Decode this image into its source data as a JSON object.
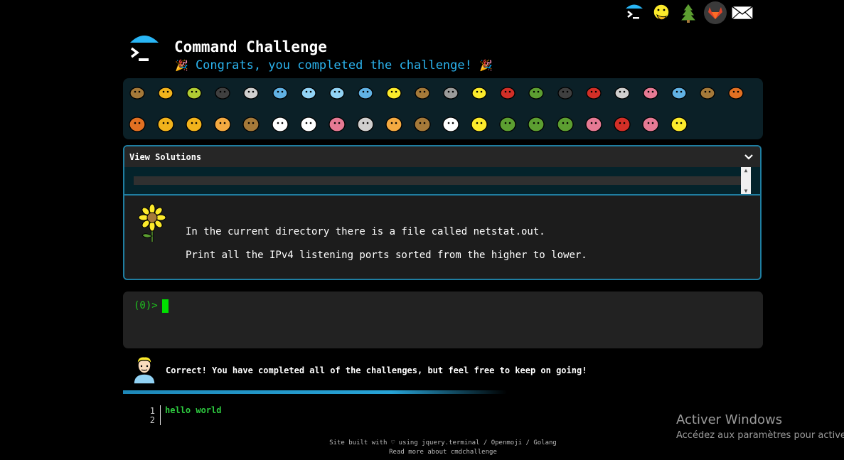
{
  "app": {
    "title": "Command Challenge",
    "subtitle": "Congrats, you completed the challenge!",
    "party_emoji": "🎉"
  },
  "top_icons": [
    "terminal-logo-icon",
    "face-with-hand-over-mouth-icon",
    "tree-icon",
    "gitlab-icon",
    "envelope-icon"
  ],
  "badges": {
    "row1": [
      "snail-icon",
      "butterfly-icon",
      "caterpillar-icon",
      "ant-icon",
      "spider-web-icon",
      "whale-icon",
      "shark-icon",
      "dolphin-icon",
      "fish-icon",
      "tropical-fish-icon",
      "hedgehog-icon",
      "wolf-icon",
      "bee-icon",
      "ladybug-icon",
      "cricket-icon",
      "spider-icon",
      "scorpion-icon",
      "fly-icon",
      "worm-icon",
      "microbe-icon",
      "monkey-icon",
      "dog-icon"
    ],
    "row2": [
      "fox-icon",
      "cat-icon",
      "lion-icon",
      "tiger-icon",
      "horse-icon",
      "unicorn-icon",
      "cow-icon",
      "pig-icon",
      "mouse-icon",
      "hamster-icon",
      "bear-icon",
      "panda-icon",
      "hatching-chick-icon",
      "peacock-icon",
      "frog-icon",
      "dragon-icon",
      "cherry-blossom-icon",
      "rose-icon",
      "hibiscus-icon",
      "sunflower-icon"
    ]
  },
  "solutions": {
    "header": "View Solutions"
  },
  "task": {
    "line1": "In the current directory there is a file called netstat.out.",
    "line2": "Print all the IPv4 listening ports sorted from the higher to lower."
  },
  "terminal": {
    "prompt": "(0)>"
  },
  "result": {
    "message": "Correct! You have completed all of the challenges, but feel free to keep on going!"
  },
  "editor": {
    "lines": [
      "1",
      "2"
    ],
    "code": "hello world"
  },
  "footer": {
    "line1": "Site built with ♡ using jquery.terminal / Openmoji / Golang",
    "line2": "Read more about cmdchallenge"
  },
  "watermark": {
    "title": "Activer Windows",
    "subtitle": "Accédez aux paramètres pour activer"
  },
  "colors": {
    "accent": "#2bb4ef",
    "terminal_green": "#1ec41e",
    "panel_border": "#1f7ea1"
  }
}
